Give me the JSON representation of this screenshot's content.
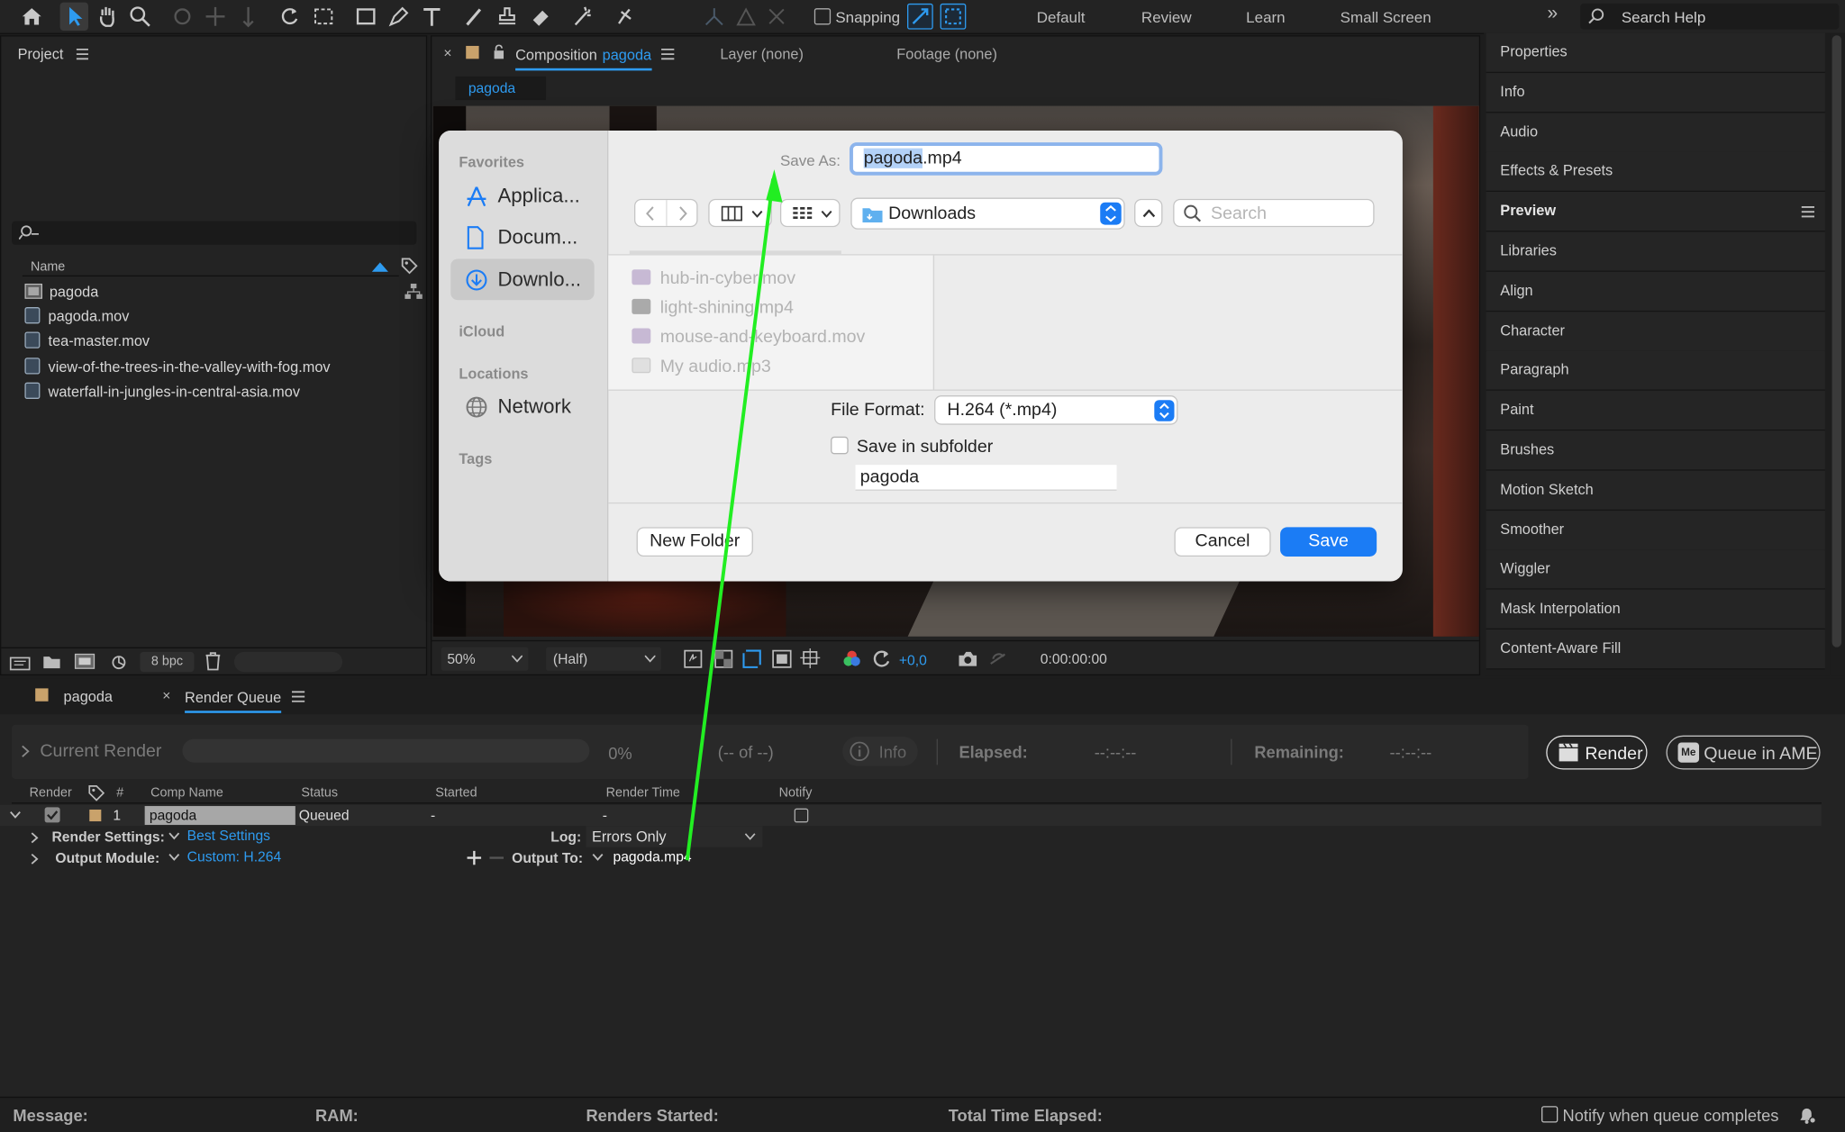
{
  "toolbar": {
    "snapping_label": "Snapping",
    "workspaces": [
      "Default",
      "Review",
      "Learn",
      "Small Screen"
    ],
    "more": "»",
    "search_help_placeholder": "Search Help"
  },
  "project": {
    "title": "Project",
    "column_name": "Name",
    "items": [
      "pagoda",
      "pagoda.mov",
      "tea-master.mov",
      "view-of-the-trees-in-the-valley-with-fog.mov",
      "waterfall-in-jungles-in-central-asia.mov"
    ],
    "bpc": "8 bpc"
  },
  "comp": {
    "tab_prefix": "Composition",
    "tab_name": "pagoda",
    "layer_tab": "Layer (none)",
    "footage_tab": "Footage (none)",
    "subtab": "pagoda",
    "zoom": "50%",
    "resolution": "(Half)",
    "exposure": "+0,0",
    "timecode": "0:00:00:00"
  },
  "right_panel": [
    "Properties",
    "Info",
    "Audio",
    "Effects & Presets",
    "Preview",
    "Libraries",
    "Align",
    "Character",
    "Paragraph",
    "Paint",
    "Brushes",
    "Motion Sketch",
    "Smoother",
    "Wiggler",
    "Mask Interpolation",
    "Content-Aware Fill"
  ],
  "dialog": {
    "sidebar": {
      "favorites": "Favorites",
      "fav_items": [
        "Applica...",
        "Docum...",
        "Downlo..."
      ],
      "icloud": "iCloud",
      "locations": "Locations",
      "network": "Network",
      "tags": "Tags"
    },
    "save_as_label": "Save As:",
    "filename_selected": "pagoda",
    "filename_ext": ".mp4",
    "location": "Downloads",
    "search_placeholder": "Search",
    "files": [
      "hub-in-cyber.mov",
      "light-shining.mp4",
      "mouse-and-keyboard.mov",
      "My audio.mp3"
    ],
    "file_format_label": "File Format:",
    "file_format": "H.264 (*.mp4)",
    "save_subfolder_label": "Save in subfolder",
    "subfolder_value": "pagoda",
    "new_folder": "New Folder",
    "cancel": "Cancel",
    "save": "Save"
  },
  "bottom_tabs": {
    "tab1": "pagoda",
    "tab2": "Render Queue"
  },
  "render_bar": {
    "current_render": "Current Render",
    "percent": "0%",
    "of": "(-- of --)",
    "info": "Info",
    "elapsed_label": "Elapsed:",
    "elapsed": "--:--:--",
    "remaining_label": "Remaining:",
    "remaining": "--:--:--",
    "render_btn": "Render",
    "queue_ame": "Queue in AME"
  },
  "rq": {
    "headers": [
      "Render",
      "#",
      "Comp Name",
      "Status",
      "Started",
      "Render Time",
      "Notify"
    ],
    "row": {
      "num": "1",
      "comp": "pagoda",
      "status": "Queued",
      "started": "-",
      "render_time": "-"
    },
    "render_settings_label": "Render Settings:",
    "render_settings": "Best Settings",
    "log_label": "Log:",
    "log": "Errors Only",
    "output_module_label": "Output Module:",
    "output_module": "Custom: H.264",
    "output_to_label": "Output To:",
    "output_to": "pagoda.mp4"
  },
  "status_bar": {
    "message": "Message:",
    "ram": "RAM:",
    "renders_started": "Renders Started:",
    "total_time": "Total Time Elapsed:",
    "notify": "Notify when queue completes"
  },
  "colors": {
    "accent_blue": "#2e9bf0",
    "annotation_arrow": "#22ee22",
    "mac_blue": "#1b7cf5"
  }
}
